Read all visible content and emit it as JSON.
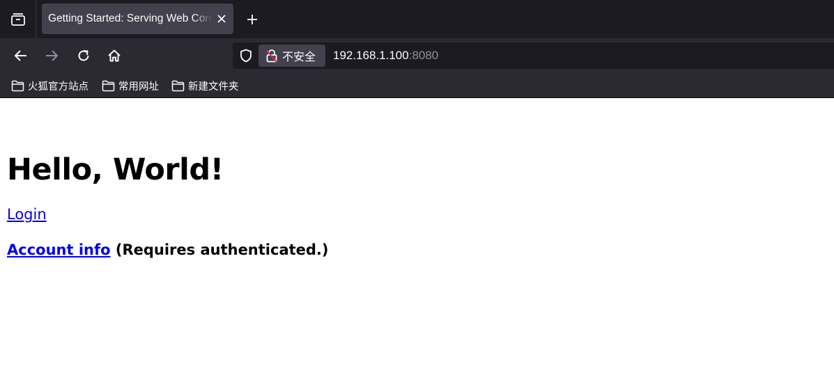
{
  "browser": {
    "tab": {
      "title": "Getting Started: Serving Web Content"
    },
    "urlbar": {
      "security_label": "不安全",
      "host": "192.168.1.100",
      "port": ":8080"
    },
    "bookmarks": [
      {
        "label": "火狐官方站点"
      },
      {
        "label": "常用网址"
      },
      {
        "label": "新建文件夹"
      }
    ],
    "icons": {
      "tab_list": "tab-list-icon",
      "close": "close-icon",
      "new_tab": "plus-icon",
      "back": "back-arrow-icon",
      "forward": "forward-arrow-icon",
      "reload": "reload-icon",
      "home": "home-icon",
      "shield": "shield-icon",
      "insecure_lock": "insecure-lock-icon",
      "folder": "folder-icon"
    },
    "colors": {
      "tabstrip_bg": "#1c1b22",
      "toolbar_bg": "#2b2a33",
      "selected_tab_bg": "#42414d",
      "insecure_slash": "#e22850"
    }
  },
  "page": {
    "heading": "Hello, World!",
    "login_link": "Login",
    "account_link": "Account info",
    "account_note": " (Requires authenticated.)",
    "link_color": "#0000ee"
  }
}
